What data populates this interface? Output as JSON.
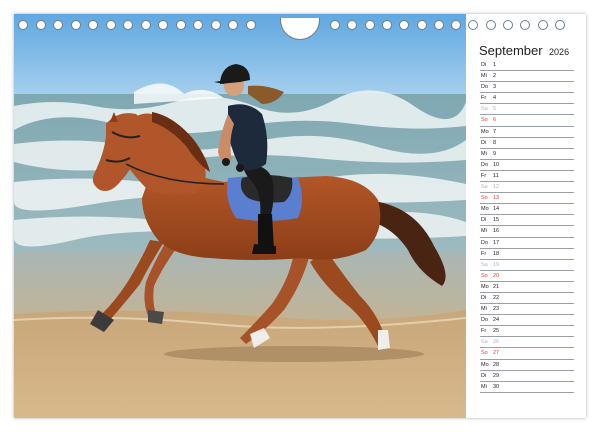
{
  "calendar": {
    "month": "September",
    "year": "2026",
    "days": [
      {
        "wd": "Di",
        "d": "1",
        "type": "weekday"
      },
      {
        "wd": "Mi",
        "d": "2",
        "type": "weekday"
      },
      {
        "wd": "Do",
        "d": "3",
        "type": "weekday"
      },
      {
        "wd": "Fr",
        "d": "4",
        "type": "weekday"
      },
      {
        "wd": "Sa",
        "d": "5",
        "type": "sat"
      },
      {
        "wd": "So",
        "d": "6",
        "type": "sun"
      },
      {
        "wd": "Mo",
        "d": "7",
        "type": "weekday"
      },
      {
        "wd": "Di",
        "d": "8",
        "type": "weekday"
      },
      {
        "wd": "Mi",
        "d": "9",
        "type": "weekday"
      },
      {
        "wd": "Do",
        "d": "10",
        "type": "weekday"
      },
      {
        "wd": "Fr",
        "d": "11",
        "type": "weekday"
      },
      {
        "wd": "Sa",
        "d": "12",
        "type": "sat"
      },
      {
        "wd": "So",
        "d": "13",
        "type": "sun"
      },
      {
        "wd": "Mo",
        "d": "14",
        "type": "weekday"
      },
      {
        "wd": "Di",
        "d": "15",
        "type": "weekday"
      },
      {
        "wd": "Mi",
        "d": "16",
        "type": "weekday"
      },
      {
        "wd": "Do",
        "d": "17",
        "type": "weekday"
      },
      {
        "wd": "Fr",
        "d": "18",
        "type": "weekday"
      },
      {
        "wd": "Sa",
        "d": "19",
        "type": "sat"
      },
      {
        "wd": "So",
        "d": "20",
        "type": "sun"
      },
      {
        "wd": "Mo",
        "d": "21",
        "type": "weekday"
      },
      {
        "wd": "Di",
        "d": "22",
        "type": "weekday"
      },
      {
        "wd": "Mi",
        "d": "23",
        "type": "weekday"
      },
      {
        "wd": "Do",
        "d": "24",
        "type": "weekday"
      },
      {
        "wd": "Fr",
        "d": "25",
        "type": "weekday"
      },
      {
        "wd": "Sa",
        "d": "26",
        "type": "sat"
      },
      {
        "wd": "So",
        "d": "27",
        "type": "sun"
      },
      {
        "wd": "Mo",
        "d": "28",
        "type": "weekday"
      },
      {
        "wd": "Di",
        "d": "29",
        "type": "weekday"
      },
      {
        "wd": "Mi",
        "d": "30",
        "type": "weekday"
      }
    ]
  },
  "colors": {
    "sunday": "#e03a3a",
    "saturday": "#b5b5b5",
    "weekday": "#222222",
    "ruling": "#9aa0a6"
  },
  "photo": {
    "subject": "rider on chestnut horse cantering along a beach"
  }
}
